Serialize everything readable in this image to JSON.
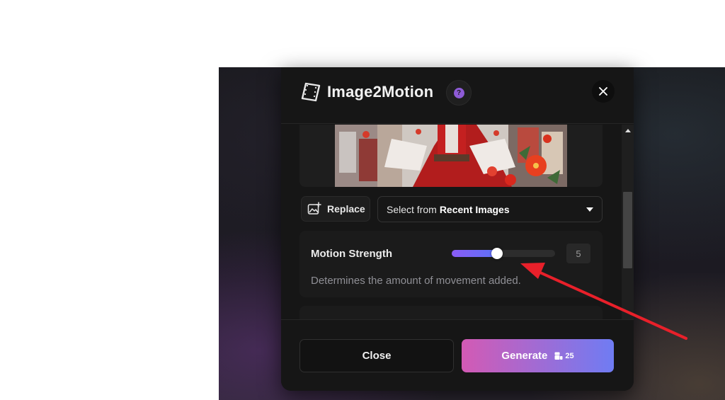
{
  "modal": {
    "title": "Image2Motion",
    "help_label": "?",
    "close_icon": "close-icon"
  },
  "image_actions": {
    "replace_label": "Replace",
    "select_prefix": "Select from",
    "select_strong": "Recent Images"
  },
  "motion_strength": {
    "label": "Motion Strength",
    "value": "5",
    "fraction": 0.44,
    "description": "Determines the amount of movement added."
  },
  "footer": {
    "close_label": "Close",
    "generate_label": "Generate",
    "credits": "25"
  },
  "colors": {
    "accent_start": "#d35ab4",
    "accent_end": "#6f7cf3",
    "slider_fill": "#8a5cf6",
    "annotation_arrow": "#e8202a"
  }
}
